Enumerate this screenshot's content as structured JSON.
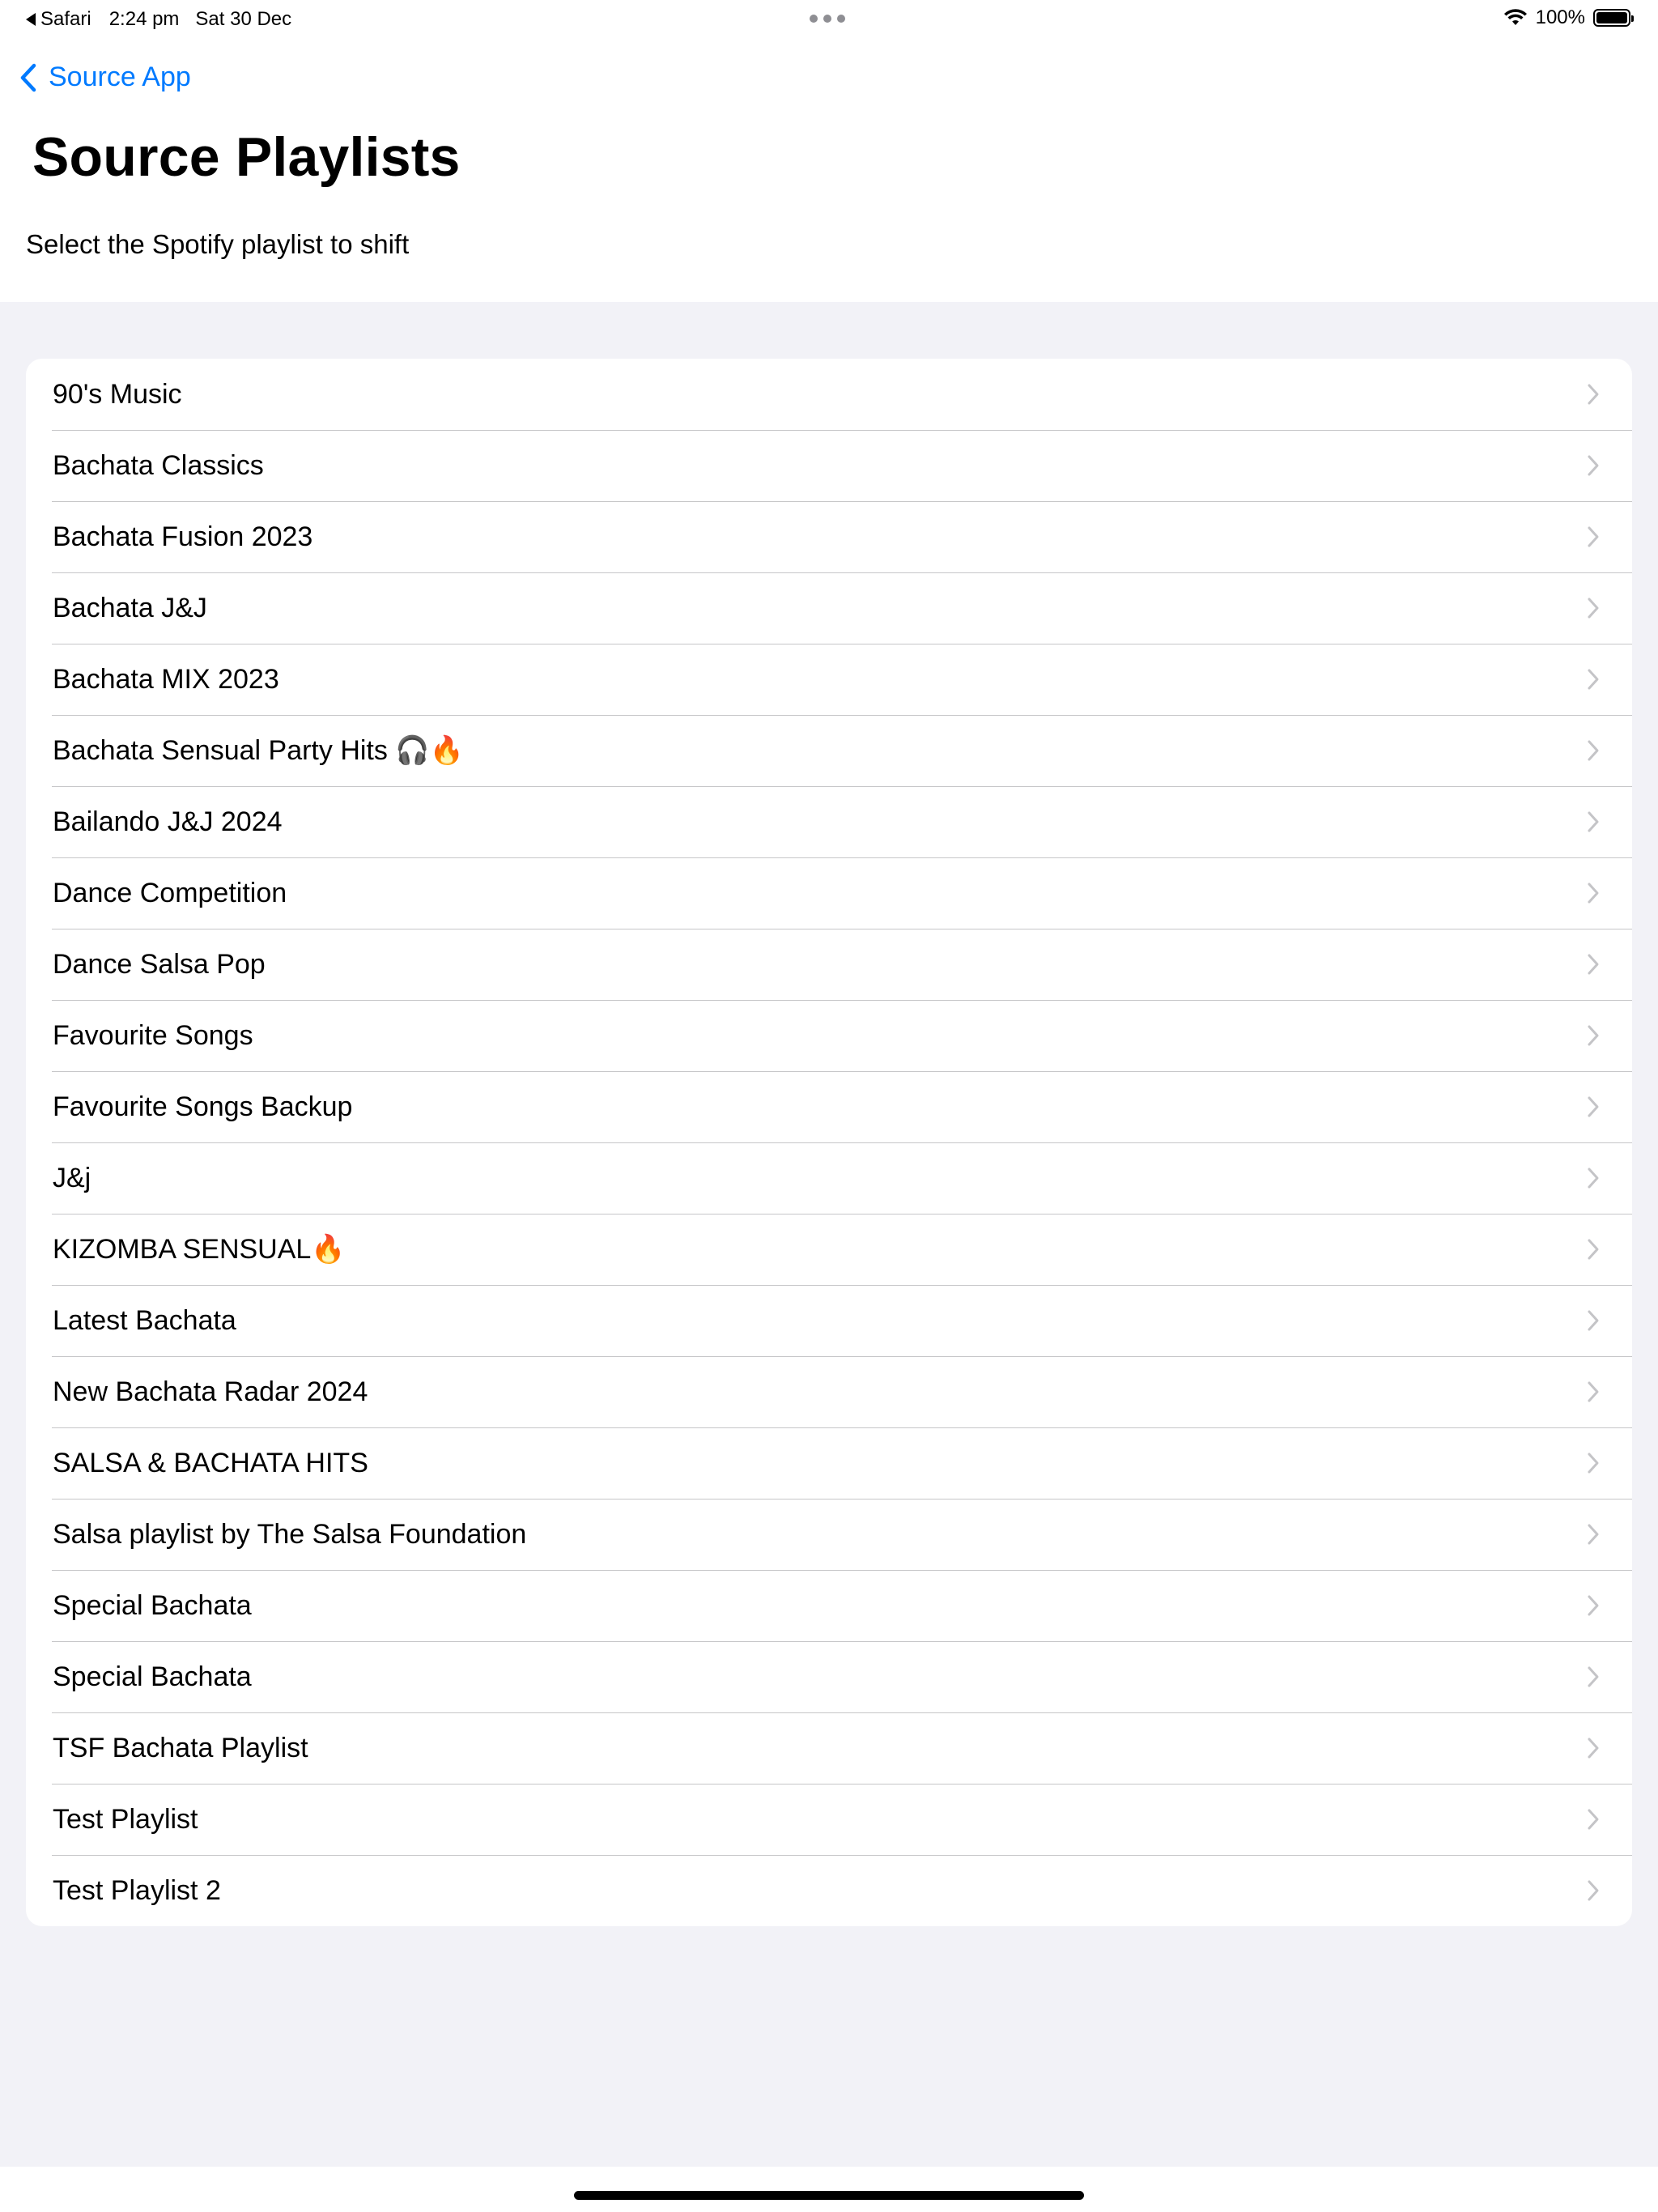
{
  "status_bar": {
    "back_app": "Safari",
    "time": "2:24 pm",
    "date": "Sat 30 Dec",
    "battery_text": "100%",
    "battery_level": 1.0
  },
  "nav": {
    "back_label": "Source App"
  },
  "header": {
    "title": "Source Playlists",
    "subtitle": "Select the Spotify playlist to shift"
  },
  "playlists": [
    "90's Music",
    "Bachata Classics",
    "Bachata Fusion 2023",
    "Bachata J&J",
    "Bachata MIX 2023",
    "Bachata Sensual Party Hits 🎧🔥",
    "Bailando J&J 2024",
    "Dance Competition",
    "Dance Salsa Pop",
    "Favourite Songs",
    "Favourite Songs Backup",
    "J&j",
    "KIZOMBA SENSUAL🔥",
    "Latest Bachata",
    "New Bachata Radar 2024",
    "SALSA & BACHATA HITS",
    "Salsa playlist by The Salsa Foundation",
    "Special Bachata",
    "Special Bachata",
    "TSF Bachata Playlist",
    "Test Playlist",
    "Test Playlist 2"
  ],
  "icons": {
    "back": "chevron-left-icon",
    "row": "chevron-right-icon",
    "wifi": "wifi-icon",
    "battery": "battery-icon"
  },
  "colors": {
    "accent": "#007aff",
    "background": "#f2f2f7",
    "separator": "#c6c6c8",
    "chevron": "#c4c4c7"
  }
}
